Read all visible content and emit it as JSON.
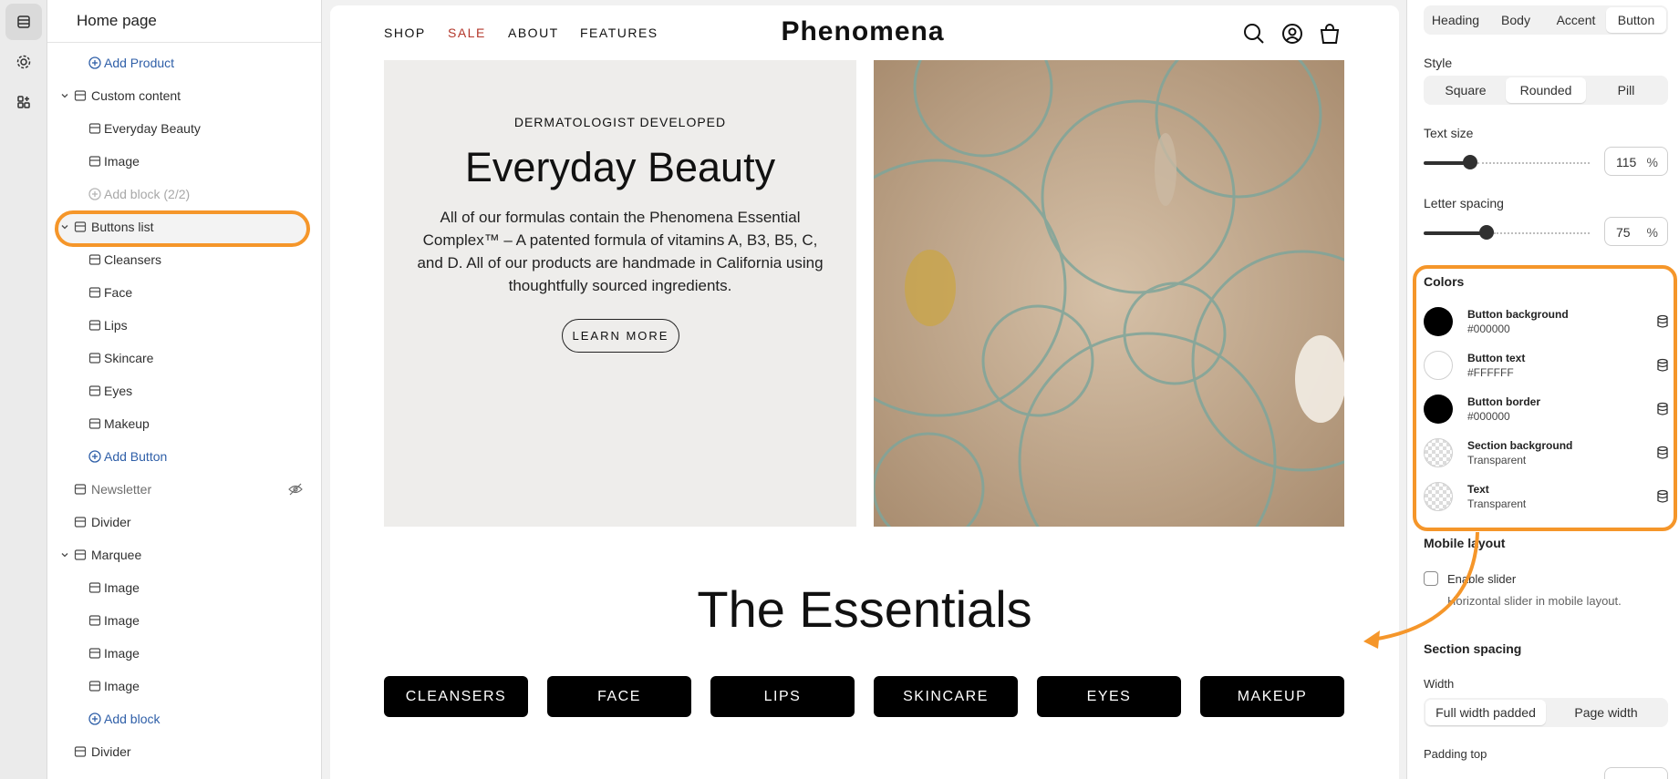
{
  "sidebar": {
    "title": "Home page",
    "items": [
      {
        "label": "Add Product",
        "kind": "add"
      },
      {
        "label": "Custom content",
        "kind": "section"
      },
      {
        "label": "Everyday Beauty",
        "kind": "block"
      },
      {
        "label": "Image",
        "kind": "block"
      },
      {
        "label": "Add block (2/2)",
        "kind": "disabled"
      },
      {
        "label": "Buttons list",
        "kind": "section"
      },
      {
        "label": "Cleansers",
        "kind": "block"
      },
      {
        "label": "Face",
        "kind": "block"
      },
      {
        "label": "Lips",
        "kind": "block"
      },
      {
        "label": "Skincare",
        "kind": "block"
      },
      {
        "label": "Eyes",
        "kind": "block"
      },
      {
        "label": "Makeup",
        "kind": "block"
      },
      {
        "label": "Add Button",
        "kind": "add"
      },
      {
        "label": "Newsletter",
        "kind": "section-hidden"
      },
      {
        "label": "Divider",
        "kind": "section"
      },
      {
        "label": "Marquee",
        "kind": "section"
      },
      {
        "label": "Image",
        "kind": "block"
      },
      {
        "label": "Image",
        "kind": "block"
      },
      {
        "label": "Image",
        "kind": "block"
      },
      {
        "label": "Image",
        "kind": "block"
      },
      {
        "label": "Add block",
        "kind": "add"
      },
      {
        "label": "Divider",
        "kind": "section"
      }
    ]
  },
  "preview": {
    "nav": {
      "links": [
        "SHOP",
        "SALE",
        "ABOUT",
        "FEATURES"
      ],
      "logo": "Phenomena"
    },
    "hero": {
      "eyebrow": "DERMATOLOGIST DEVELOPED",
      "title": "Everyday Beauty",
      "body": "All of our formulas contain the Phenomena Essential Complex™ – A patented formula of vitamins A, B3, B5, C, and D. All of our products are handmade in California using thoughtfully sourced ingredients.",
      "button": "LEARN MORE"
    },
    "essentials_title": "The Essentials",
    "buttons": [
      "CLEANSERS",
      "FACE",
      "LIPS",
      "SKINCARE",
      "EYES",
      "MAKEUP"
    ]
  },
  "settings": {
    "type_tabs": [
      "Heading",
      "Body",
      "Accent",
      "Button"
    ],
    "style_label": "Style",
    "style_options": [
      "Square",
      "Rounded",
      "Pill"
    ],
    "text_size_label": "Text size",
    "text_size": {
      "value": "115",
      "unit": "%",
      "level": 0.28
    },
    "letter_spacing_label": "Letter spacing",
    "letter_spacing": {
      "value": "75",
      "unit": "%",
      "level": 0.38
    },
    "colors_label": "Colors",
    "colors": [
      {
        "name": "Button background",
        "value": "#000000",
        "swatch": "black"
      },
      {
        "name": "Button text",
        "value": "#FFFFFF",
        "swatch": "white"
      },
      {
        "name": "Button border",
        "value": "#000000",
        "swatch": "black"
      },
      {
        "name": "Section background",
        "value": "Transparent",
        "swatch": "transparent"
      },
      {
        "name": "Text",
        "value": "Transparent",
        "swatch": "transparent"
      }
    ],
    "mobile_layout_label": "Mobile layout",
    "enable_slider_label": "Enable slider",
    "enable_slider_help": "Horizontal slider in mobile layout.",
    "section_spacing_label": "Section spacing",
    "width_label": "Width",
    "width_options": [
      "Full width padded",
      "Page width"
    ],
    "padding_top_label": "Padding top"
  },
  "accent_color": "#f5962a"
}
